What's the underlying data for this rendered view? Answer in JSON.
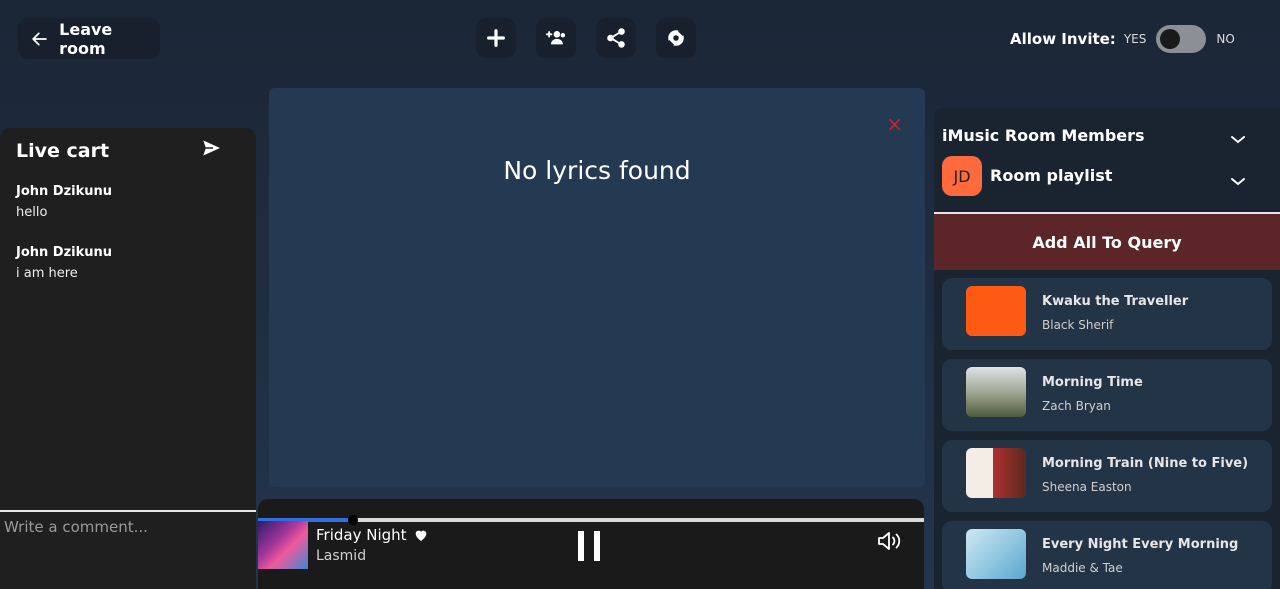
{
  "header": {
    "leave_label": "Leave room",
    "allow_invite_label": "Allow Invite:",
    "invite_yes": "YES",
    "invite_no": "NO",
    "invite_enabled": false,
    "tools": [
      "add-icon",
      "add-users-icon",
      "share-icon",
      "settings-icon"
    ]
  },
  "chat": {
    "title": "Live cart",
    "messages": [
      {
        "author": "John Dzikunu",
        "text": "hello"
      },
      {
        "author": "John Dzikunu",
        "text": "i am here"
      }
    ],
    "input_placeholder": "Write a comment..."
  },
  "lyrics": {
    "message": "No lyrics found",
    "close_icon": "×"
  },
  "player": {
    "title": "Friday Night",
    "artist": "Lasmid",
    "progress_fraction": 0.143,
    "liked": true
  },
  "side": {
    "members_title": "iMusic Room Members",
    "avatar_initials": "JD",
    "playlist_title": "Room playlist",
    "add_all_label": "Add All To Query",
    "songs": [
      {
        "title": "Kwaku the Traveller",
        "artist": "Black Sherif",
        "art_color": "#ff5a14"
      },
      {
        "title": "Morning Time",
        "artist": "Zach Bryan",
        "art_color": "#6b7a5a"
      },
      {
        "title": "Morning Train (Nine to Five)",
        "artist": "Sheena Easton",
        "art_color": "#e8e0d8"
      },
      {
        "title": "Every Night Every Morning",
        "artist": "Maddie & Tae",
        "art_color": "#8fc6e0"
      }
    ]
  },
  "colors": {
    "accent_progress": "#2f6fe0",
    "add_all_bg": "#5c2629",
    "close_red": "#e21b1b",
    "avatar_bg": "#ff6a3d"
  }
}
